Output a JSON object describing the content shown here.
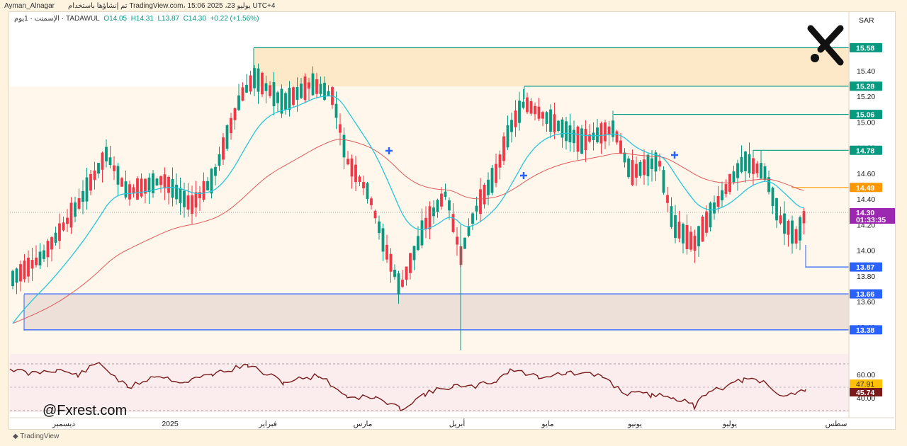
{
  "header": {
    "author": "Ayman_Alnagar",
    "published": "تم إنشاؤها باستخدام TradingView.com، يوليو 23، 2025 15:06 UTC+4"
  },
  "symbol_line": {
    "symbol": "الإسمنت · 1يوم · TADAWUL",
    "open": "O14.05",
    "high": "H14.31",
    "low": "L13.87",
    "close": "C14.30",
    "change": "+0.22 (+1.56%)"
  },
  "currency": "SAR",
  "brand": {
    "logo_icon": "x-logo-icon"
  },
  "watermark": "@Fxrest.com",
  "footer": "TradingView",
  "colors": {
    "up": "#089981",
    "down": "#f23645",
    "ema_fast": "#26c6da",
    "ema_slow": "#e05a5a",
    "resistance_line": "#089981",
    "support_line": "#2962ff",
    "orange": "#ff9800",
    "rsi": "#7b1a1a",
    "current": "#9c27b0"
  },
  "price_axis": {
    "ticks": [
      "15.40",
      "15.20",
      "15.00",
      "14.80",
      "14.60",
      "14.40",
      "14.20",
      "14.00",
      "13.80",
      "13.60",
      "13.40"
    ],
    "levels": [
      {
        "label": "15.58",
        "color": "#089981"
      },
      {
        "label": "15.28",
        "color": "#089981"
      },
      {
        "label": "15.06",
        "color": "#089981"
      },
      {
        "label": "14.78",
        "color": "#089981"
      },
      {
        "label": "14.49",
        "color": "#ff9800"
      },
      {
        "label": "13.87",
        "color": "#2962ff"
      },
      {
        "label": "13.66",
        "color": "#2962ff"
      },
      {
        "label": "13.38",
        "color": "#2962ff"
      }
    ],
    "current_price": "14.30",
    "countdown": "01:33:35"
  },
  "rsi_axis": {
    "ticks": [
      "60.00",
      "40.00"
    ],
    "badge_upper": "47.91",
    "badge_lower": "45.74"
  },
  "time_axis": [
    "ديسمبر",
    "2025",
    "فبراير",
    "مارس",
    "أبريل",
    "مايو",
    "يونيو",
    "يوليو",
    "سطس"
  ],
  "chart_data": {
    "type": "candlestick",
    "symbol": "TADAWUL",
    "timeframe": "1D",
    "last_bar": {
      "open": 14.05,
      "high": 14.31,
      "low": 13.87,
      "close": 14.3
    },
    "resistance_levels": [
      15.58,
      15.28,
      15.06,
      14.78,
      14.49
    ],
    "support_levels": [
      13.87,
      13.66,
      13.38
    ],
    "zones": [
      {
        "name": "supply",
        "from": 15.28,
        "to": 15.58
      },
      {
        "name": "demand",
        "from": 13.38,
        "to": 13.66
      }
    ],
    "ylim": [
      13.25,
      15.65
    ],
    "rsi_levels": [
      60,
      40
    ],
    "rsi_last": 45.74,
    "rsi_ma": 47.91
  }
}
